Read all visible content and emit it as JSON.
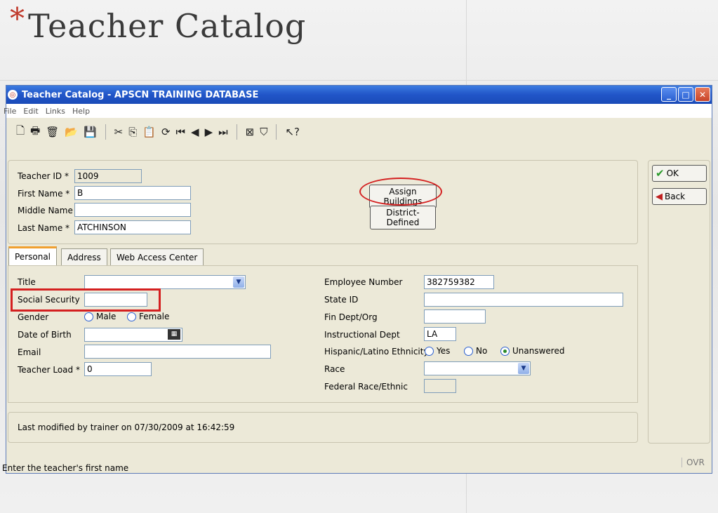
{
  "slide": {
    "title": "Teacher Catalog",
    "bullet": "*"
  },
  "window": {
    "title": "Teacher Catalog - APSCN TRAINING DATABASE",
    "controls": {
      "minimize": "_",
      "maximize": "□",
      "close": "✕"
    }
  },
  "menu": [
    "File",
    "Edit",
    "Links",
    "Help"
  ],
  "toolbar_icons": [
    "new-icon",
    "print-icon",
    "delete-icon",
    "open-icon",
    "save-icon",
    "cut-icon",
    "copy-icon",
    "paste-icon",
    "refresh-icon",
    "first-record-icon",
    "prev-record-icon",
    "next-record-icon",
    "last-record-icon",
    "report-icon",
    "filter-icon",
    "help-icon"
  ],
  "header": {
    "teacher_id_label": "Teacher ID *",
    "teacher_id": "1009",
    "first_name_label": "First Name *",
    "first_name": "B",
    "middle_name_label": "Middle Name",
    "middle_name": "",
    "last_name_label": "Last Name *",
    "last_name": "ATCHINSON",
    "assign_buildings": "Assign Buildings",
    "district_defined": "District-Defined"
  },
  "side_buttons": {
    "ok": "OK",
    "back": "Back"
  },
  "tabs": [
    "Personal",
    "Address",
    "Web Access Center"
  ],
  "personal": {
    "title_label": "Title",
    "title_value": "",
    "ssn_label": "Social Security",
    "ssn_value": "",
    "gender_label": "Gender",
    "gender_male": "Male",
    "gender_female": "Female",
    "dob_label": "Date of Birth",
    "dob_value": "",
    "email_label": "Email",
    "email_value": "",
    "load_label": "Teacher Load *",
    "load_value": "0",
    "emp_num_label": "Employee Number",
    "emp_num": "382759382",
    "state_id_label": "State ID",
    "state_id": "",
    "fin_dept_label": "Fin Dept/Org",
    "fin_dept": "",
    "instr_dept_label": "Instructional Dept",
    "instr_dept": "LA",
    "hispanic_label": "Hispanic/Latino Ethnicity",
    "hisp_yes": "Yes",
    "hisp_no": "No",
    "hisp_unanswered": "Unanswered",
    "race_label": "Race",
    "race_value": "",
    "fed_race_label": "Federal Race/Ethnic",
    "fed_race": ""
  },
  "modified": "Last modified by trainer  on  07/30/2009  at  16:42:59",
  "status": {
    "message": "Enter the teacher's first name",
    "mode": "OVR"
  },
  "colors": {
    "highlight": "#d42020",
    "titlebar": "#2155c8"
  }
}
